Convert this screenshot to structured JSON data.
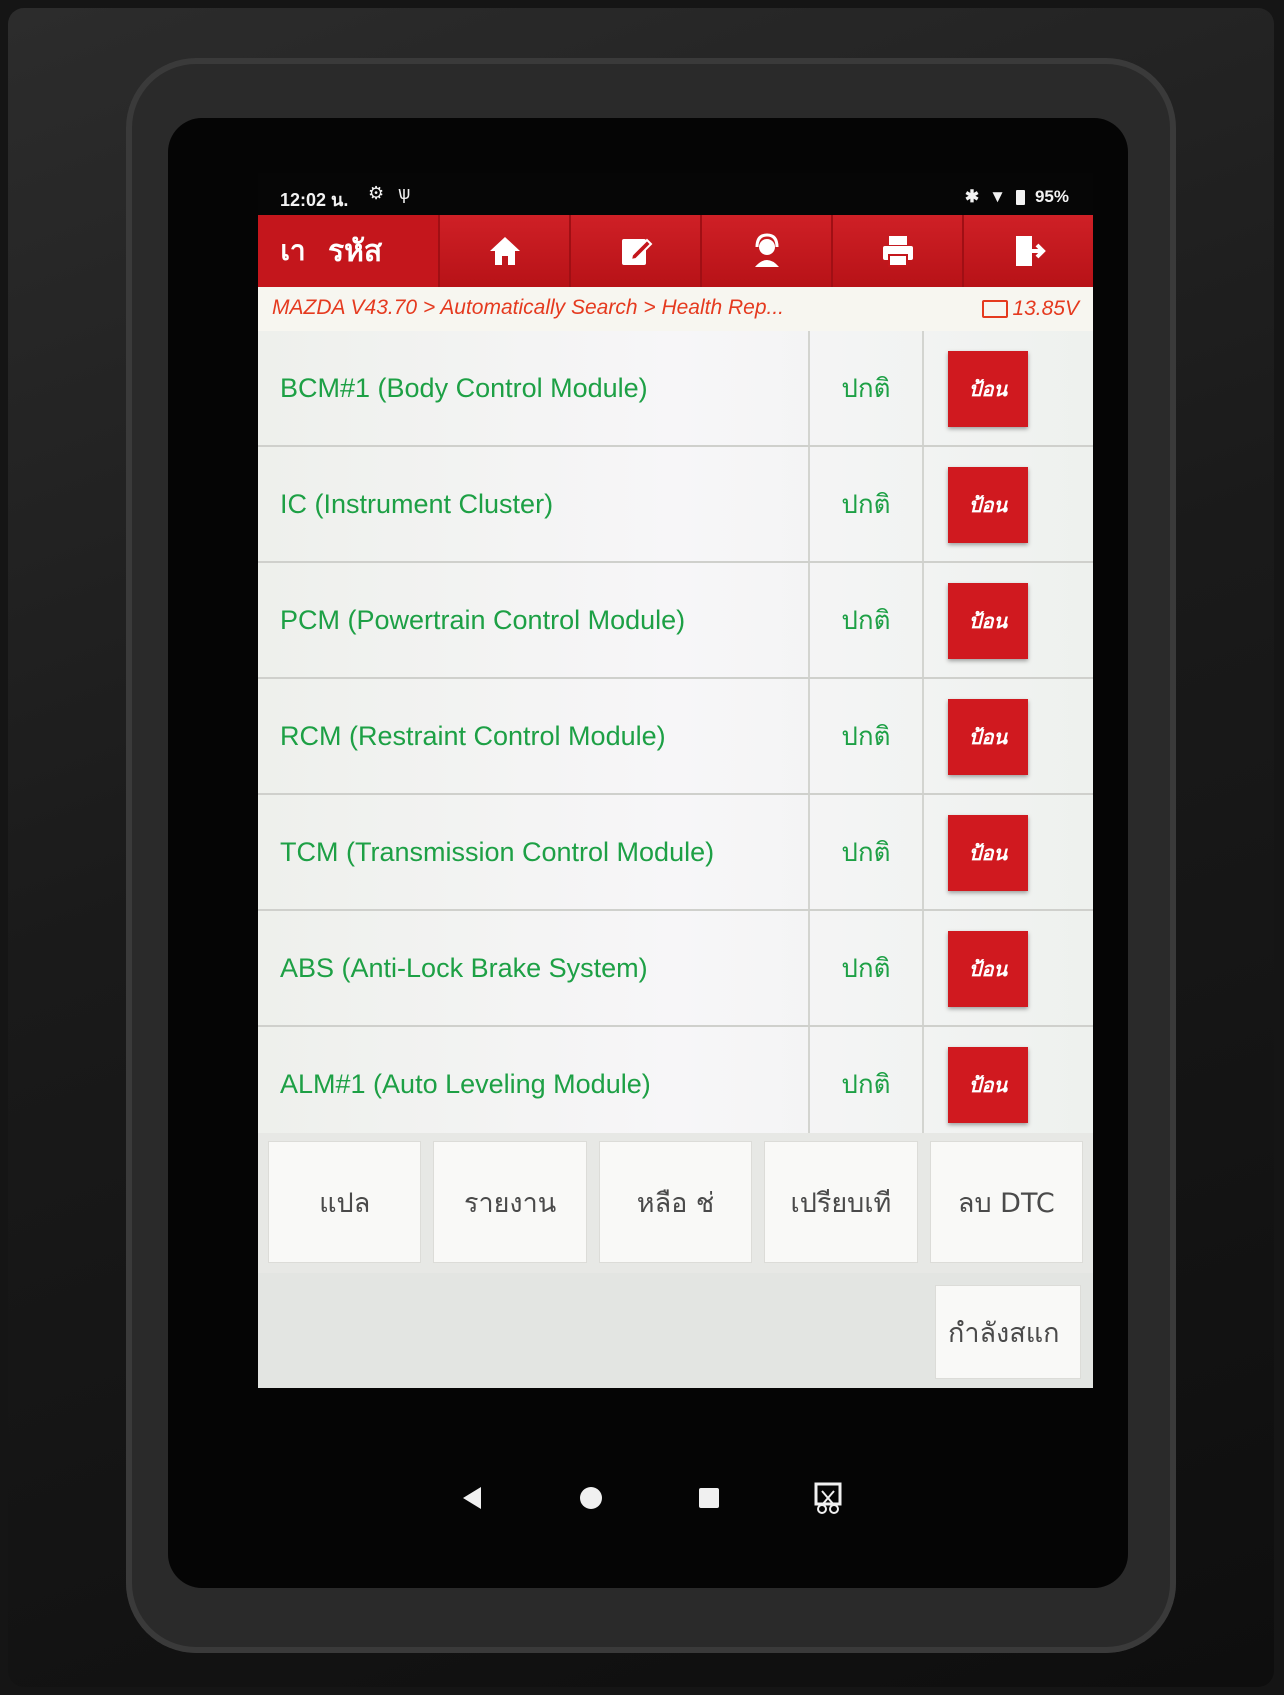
{
  "statusbar": {
    "time": "12:02 น.",
    "icon1": "settings-icon",
    "icon2": "usb-icon",
    "bluetooth": "bluetooth-icon",
    "wifi": "wifi-icon",
    "battery": "95%"
  },
  "toolbar": {
    "back_label": "เา",
    "title": "รหัส",
    "buttons": [
      "home-icon",
      "edit-icon",
      "support-icon",
      "print-icon",
      "exit-icon"
    ],
    "color": "#c4161c"
  },
  "breadcrumb": {
    "path": "MAZDA V43.70 > Automatically Search > Health Rep...",
    "voltage": "13.85V"
  },
  "modules": [
    {
      "name": "BCM#1 (Body Control Module)",
      "status": "ปกติ",
      "button": "ป้อน"
    },
    {
      "name": "IC (Instrument Cluster)",
      "status": "ปกติ",
      "button": "ป้อน"
    },
    {
      "name": "PCM (Powertrain Control Module)",
      "status": "ปกติ",
      "button": "ป้อน"
    },
    {
      "name": "RCM (Restraint Control Module)",
      "status": "ปกติ",
      "button": "ป้อน"
    },
    {
      "name": "TCM (Transmission Control Module)",
      "status": "ปกติ",
      "button": "ป้อน"
    },
    {
      "name": "ABS (Anti-Lock Brake System)",
      "status": "ปกติ",
      "button": "ป้อน"
    },
    {
      "name": "ALM#1 (Auto Leveling Module)",
      "status": "ปกติ",
      "button": "ป้อน"
    }
  ],
  "actions": [
    "แปล",
    "รายงาน",
    "หลือ ช่",
    "เปรียบเที",
    "ลบ DTC"
  ],
  "scan_button": "กำลังสแก",
  "navbar": [
    "back-icon",
    "home-circle-icon",
    "recents-icon",
    "screenshot-icon"
  ]
}
